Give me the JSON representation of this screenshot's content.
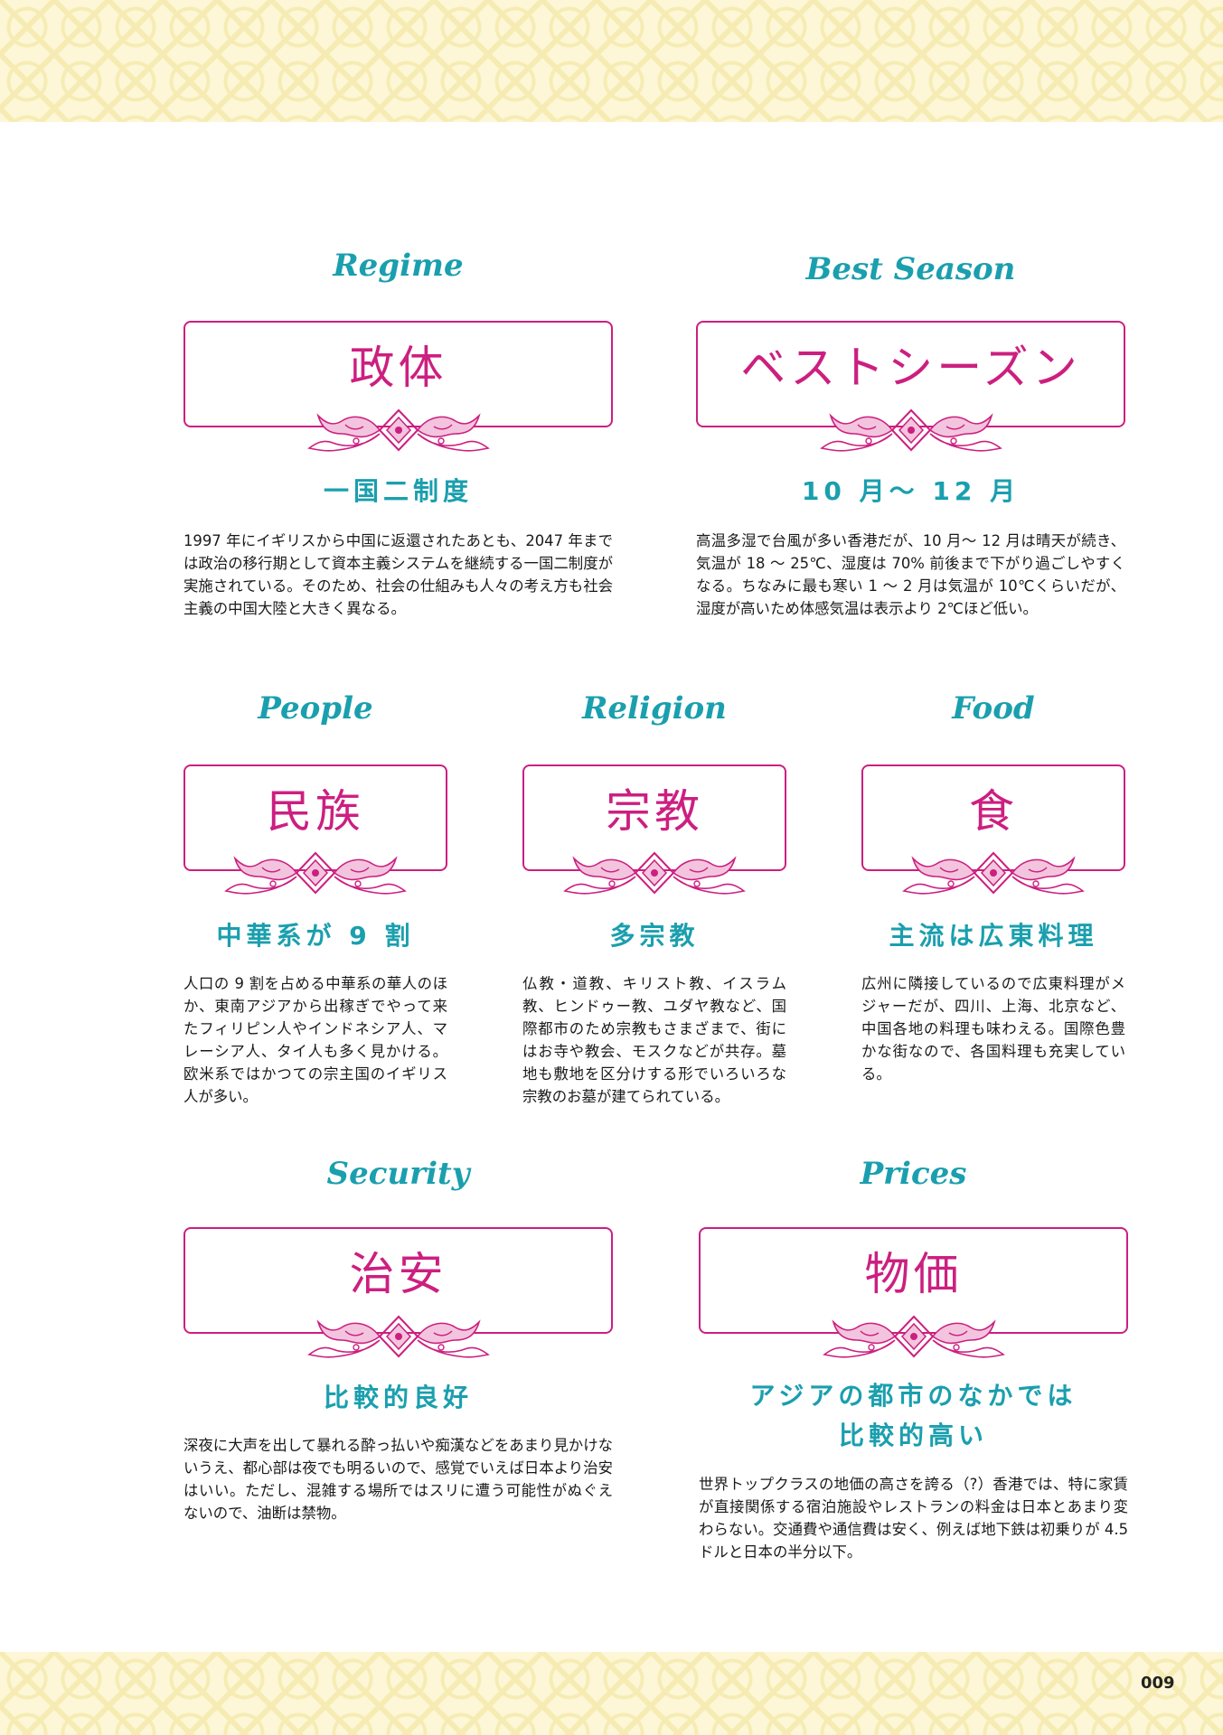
{
  "colors": {
    "teal": "#1a9fae",
    "magenta": "#cc1f80",
    "pattern": "#fdf7d8"
  },
  "sections": {
    "regime": {
      "en": "Regime",
      "jp": "政体",
      "heading": "一国二制度",
      "body": "1997 年にイギリスから中国に返還されたあとも、2047 年までは政治の移行期として資本主義システムを継続する一国二制度が実施されている。そのため、社会の仕組みも人々の考え方も社会主義の中国大陸と大きく異なる。"
    },
    "season": {
      "en": "Best Season",
      "jp": "ベストシーズン",
      "heading": "10 月～ 12 月",
      "body": "高温多湿で台風が多い香港だが、10 月～ 12 月は晴天が続き、気温が 18 ～ 25℃、湿度は 70% 前後まで下がり過ごしやすくなる。ちなみに最も寒い 1 ～ 2 月は気温が 10℃くらいだが、湿度が高いため体感気温は表示より 2℃ほど低い。"
    },
    "people": {
      "en": "People",
      "jp": "民族",
      "heading": "中華系が 9 割",
      "body": "人口の 9 割を占める中華系の華人のほか、東南アジアから出稼ぎでやって来たフィリピン人やインドネシア人、マレーシア人、タイ人も多く見かける。欧米系ではかつての宗主国のイギリス人が多い。"
    },
    "religion": {
      "en": "Religion",
      "jp": "宗教",
      "heading": "多宗教",
      "body": "仏教・道教、キリスト教、イスラム教、ヒンドゥー教、ユダヤ教など、国際都市のため宗教もさまざまで、街にはお寺や教会、モスクなどが共存。墓地も敷地を区分けする形でいろいろな宗教のお墓が建てられている。"
    },
    "food": {
      "en": "Food",
      "jp": "食",
      "heading": "主流は広東料理",
      "body": "広州に隣接しているので広東料理がメジャーだが、四川、上海、北京など、中国各地の料理も味わえる。国際色豊かな街なので、各国料理も充実している。"
    },
    "security": {
      "en": "Security",
      "jp": "治安",
      "heading": "比較的良好",
      "body": "深夜に大声を出して暴れる酔っ払いや痴漢などをあまり見かけないうえ、都心部は夜でも明るいので、感覚でいえば日本より治安はいい。ただし、混雑する場所ではスリに遭う可能性がぬぐえないので、油断は禁物。"
    },
    "prices": {
      "en": "Prices",
      "jp": "物価",
      "heading_line1": "アジアの都市のなかでは",
      "heading_line2": "比較的高い",
      "body": "世界トップクラスの地価の高さを誇る（?）香港では、特に家賃が直接関係する宿泊施設やレストランの料金は日本とあまり変わらない。交通費や通信費は安く、例えば地下鉄は初乗りが 4.5 ドルと日本の半分以下。"
    }
  },
  "page_number": "009"
}
